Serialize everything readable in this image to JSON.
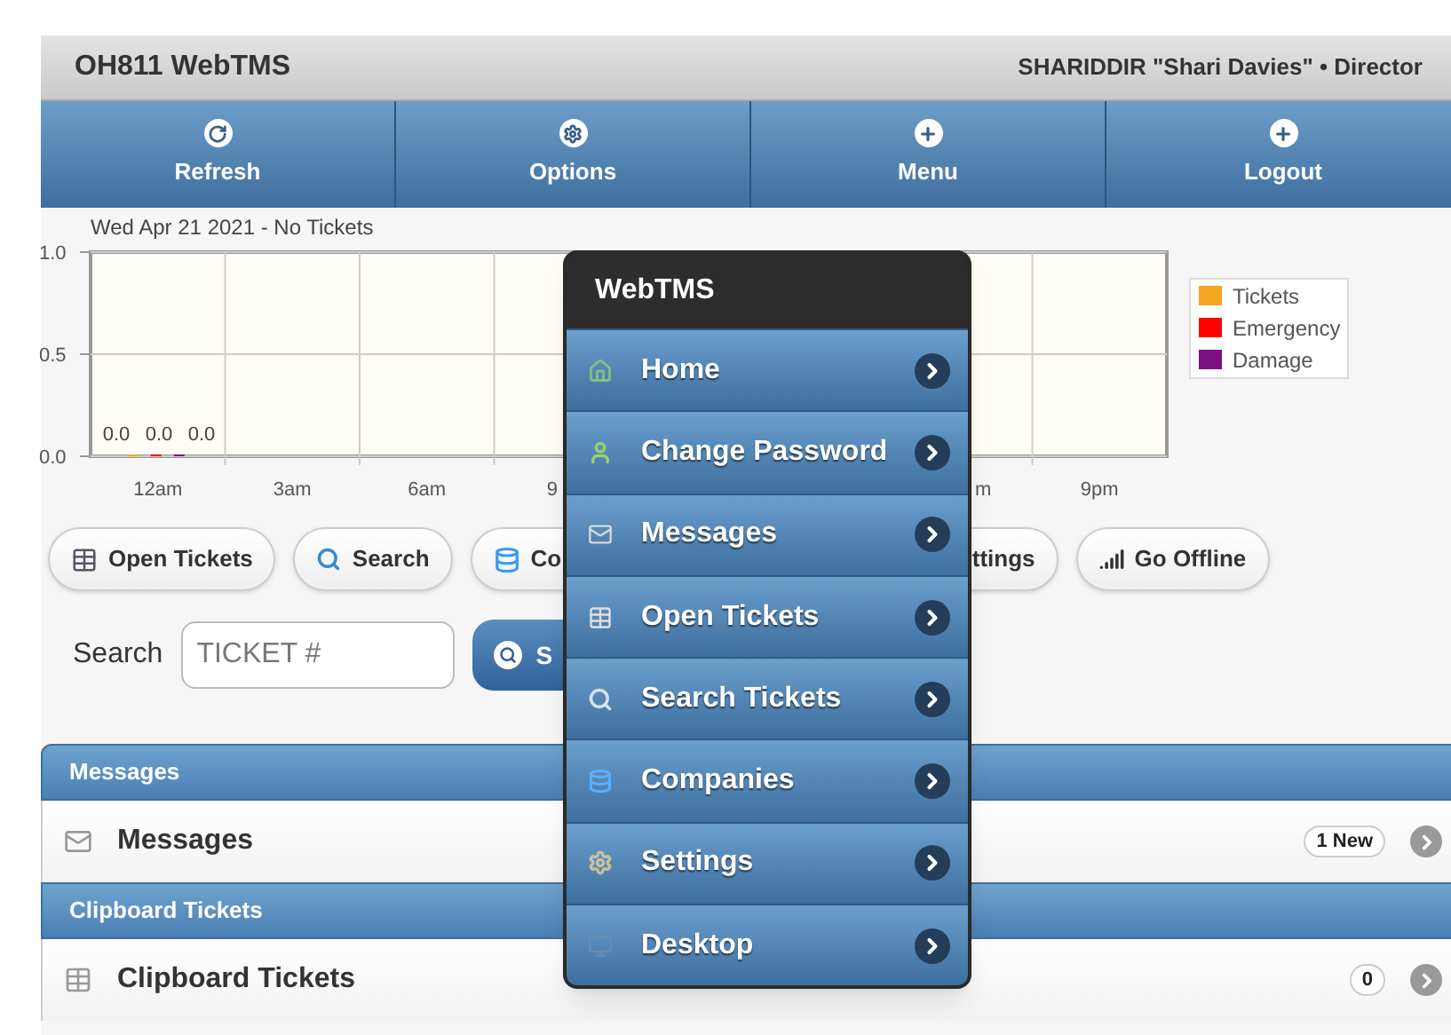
{
  "header": {
    "title": "OH811 WebTMS",
    "user": "SHARIDDIR \"Shari Davies\" • Director"
  },
  "nav": [
    {
      "label": "Refresh"
    },
    {
      "label": "Options"
    },
    {
      "label": "Menu"
    },
    {
      "label": "Logout"
    }
  ],
  "chart": {
    "chart_data": {
      "type": "bar",
      "title": "Wed Apr 21 2021 - No Tickets",
      "categories": [
        "12am",
        "3am",
        "6am",
        "9",
        null,
        null,
        "m",
        "9pm"
      ],
      "ylim": [
        0,
        1
      ],
      "legend": "right",
      "yticks": [
        {
          "value": 0,
          "label": "0.0"
        },
        {
          "value": 0.5,
          "label": "0.5"
        },
        {
          "value": 1,
          "label": "1.0"
        }
      ],
      "series": [
        {
          "name": "Tickets",
          "color": "#f5a623",
          "values": [
            0,
            null,
            null,
            null,
            null,
            null,
            null,
            null
          ],
          "value_labels": [
            "0.0",
            null,
            null,
            null,
            null,
            null,
            null,
            null
          ]
        },
        {
          "name": "Emergency",
          "color": "#ff0000",
          "values": [
            0,
            null,
            null,
            null,
            null,
            null,
            null,
            null
          ],
          "value_labels": [
            "0.0",
            null,
            null,
            null,
            null,
            null,
            null,
            null
          ]
        },
        {
          "name": "Damage",
          "color": "#7b1080",
          "values": [
            0,
            null,
            null,
            null,
            null,
            null,
            null,
            null
          ],
          "value_labels": [
            "0.0",
            null,
            null,
            null,
            null,
            null,
            null,
            null
          ]
        }
      ]
    }
  },
  "quick_buttons": [
    {
      "label": "Open Tickets"
    },
    {
      "label": "Search"
    },
    {
      "label": "Co"
    },
    {
      "label": "ttings"
    },
    {
      "label": "Go Offline"
    }
  ],
  "search": {
    "label": "Search",
    "placeholder": "TICKET #",
    "button": "S"
  },
  "sections": [
    {
      "heading": "Messages",
      "row": {
        "label": "Messages",
        "badge": "1 New"
      }
    },
    {
      "heading": "Clipboard Tickets",
      "row": {
        "label": "Clipboard Tickets",
        "badge": "0"
      }
    }
  ],
  "popup": {
    "title": "WebTMS",
    "items": [
      {
        "label": "Home"
      },
      {
        "label": "Change Password"
      },
      {
        "label": "Messages"
      },
      {
        "label": "Open Tickets"
      },
      {
        "label": "Search Tickets"
      },
      {
        "label": "Companies"
      },
      {
        "label": "Settings"
      },
      {
        "label": "Desktop"
      }
    ]
  }
}
